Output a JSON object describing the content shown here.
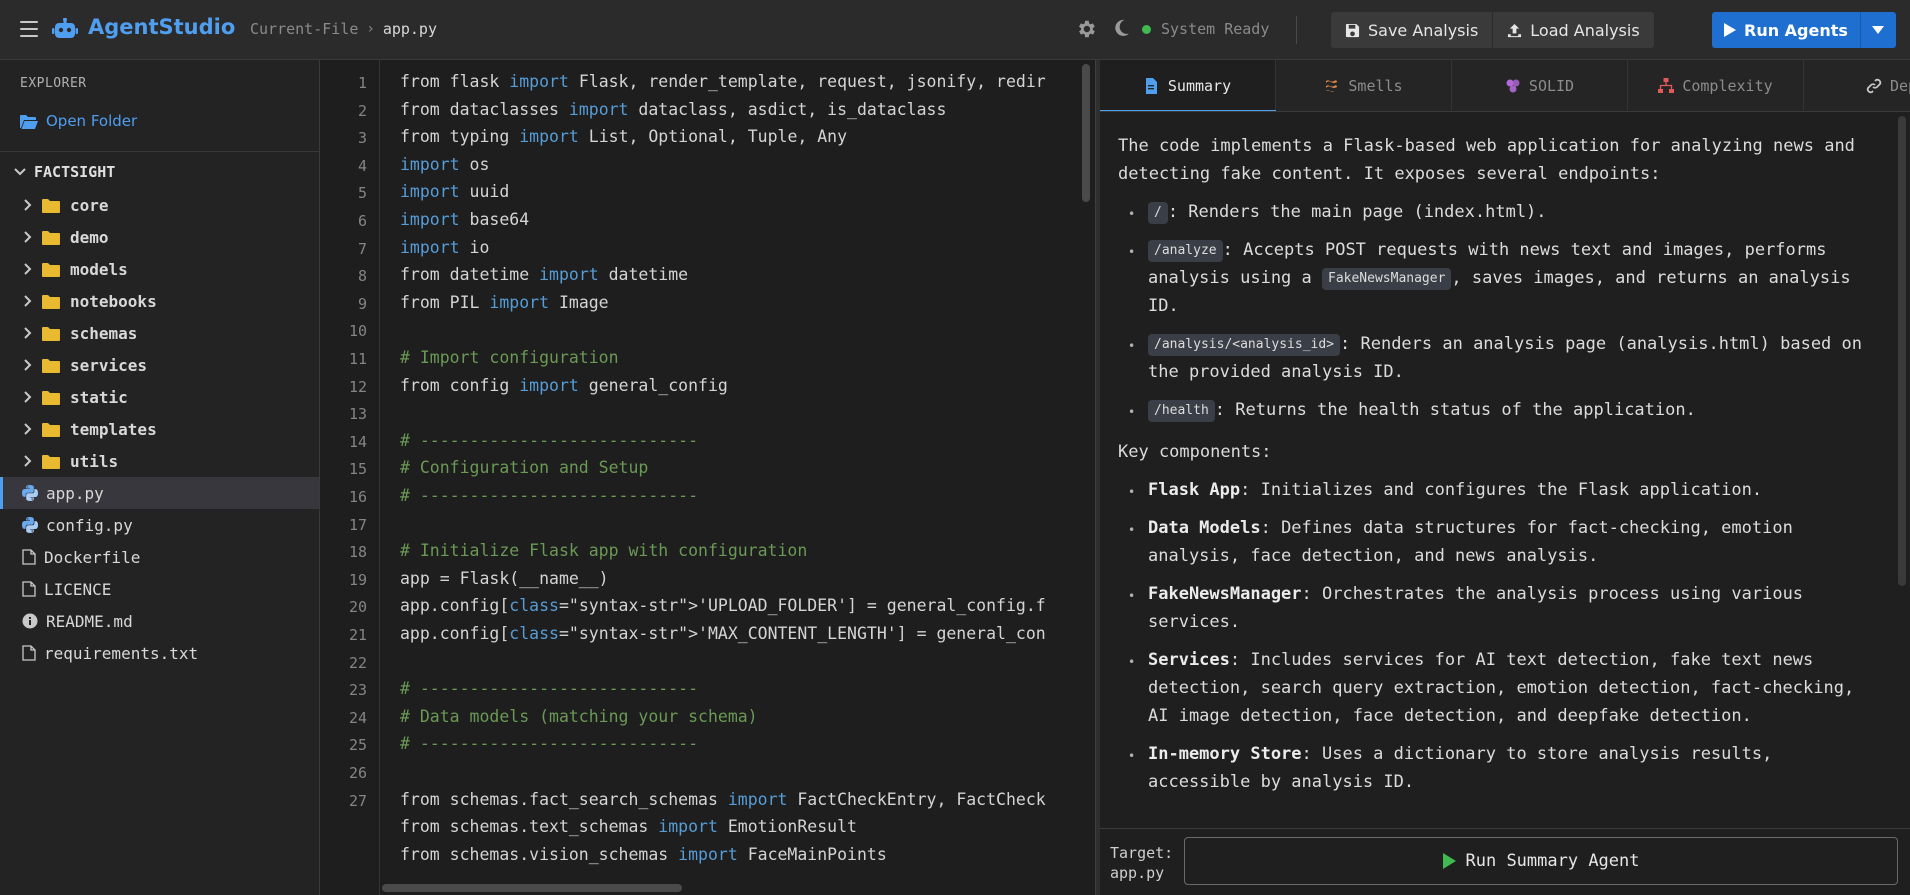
{
  "header": {
    "app_title": "AgentStudio",
    "breadcrumb_root": "Current-File",
    "breadcrumb_file": "app.py",
    "status": "System Ready",
    "save_label": "Save Analysis",
    "load_label": "Load Analysis",
    "run_label": "Run Agents"
  },
  "sidebar": {
    "title": "EXPLORER",
    "open_folder": "Open Folder",
    "project": "FACTSIGHT",
    "folders": [
      "core",
      "demo",
      "models",
      "notebooks",
      "schemas",
      "services",
      "static",
      "templates",
      "utils"
    ],
    "files": [
      {
        "name": "app.py",
        "icon": "python-icon",
        "active": true
      },
      {
        "name": "config.py",
        "icon": "python-icon",
        "active": false
      },
      {
        "name": "Dockerfile",
        "icon": "file-icon",
        "active": false
      },
      {
        "name": "LICENCE",
        "icon": "file-icon",
        "active": false
      },
      {
        "name": "README.md",
        "icon": "info-icon",
        "active": false
      },
      {
        "name": "requirements.txt",
        "icon": "file-icon",
        "active": false
      }
    ]
  },
  "editor": {
    "lines": [
      [
        [
          "",
          "from flask "
        ],
        [
          "kw",
          "import"
        ],
        [
          "",
          " Flask, render_template, request, jsonify, redir"
        ]
      ],
      [
        [
          "",
          "from dataclasses "
        ],
        [
          "kw",
          "import"
        ],
        [
          "",
          " dataclass, asdict, is_dataclass"
        ]
      ],
      [
        [
          "",
          "from typing "
        ],
        [
          "kw",
          "import"
        ],
        [
          "",
          " List, Optional, Tuple, Any"
        ]
      ],
      [
        [
          "kw",
          "import"
        ],
        [
          "",
          " os"
        ]
      ],
      [
        [
          "kw",
          "import"
        ],
        [
          "",
          " uuid"
        ]
      ],
      [
        [
          "kw",
          "import"
        ],
        [
          "",
          " base64"
        ]
      ],
      [
        [
          "kw",
          "import"
        ],
        [
          "",
          " io"
        ]
      ],
      [
        [
          "",
          "from datetime "
        ],
        [
          "kw",
          "import"
        ],
        [
          "",
          " datetime"
        ]
      ],
      [
        [
          "",
          "from PIL "
        ],
        [
          "kw",
          "import"
        ],
        [
          "",
          " Image"
        ]
      ],
      [
        [
          "",
          ""
        ]
      ],
      [
        [
          "cm",
          "# Import configuration"
        ]
      ],
      [
        [
          "",
          "from config "
        ],
        [
          "kw",
          "import"
        ],
        [
          "",
          " general_config"
        ]
      ],
      [
        [
          "",
          ""
        ]
      ],
      [
        [
          "cm",
          "# ----------------------------"
        ]
      ],
      [
        [
          "cm",
          "# Configuration and Setup"
        ]
      ],
      [
        [
          "cm",
          "# ----------------------------"
        ]
      ],
      [
        [
          "",
          ""
        ]
      ],
      [
        [
          "cm",
          "# Initialize Flask app with configuration"
        ]
      ],
      [
        [
          "",
          "app = Flask(__name__)"
        ]
      ],
      [
        [
          "",
          "app.config["
        ],
        [
          "kw",
          "class"
        ],
        [
          "",
          "=\"syntax-str\">'UPLOAD_FOLDER'] = general_config.f"
        ]
      ],
      [
        [
          "",
          "app.config["
        ],
        [
          "kw",
          "class"
        ],
        [
          "",
          "=\"syntax-str\">'MAX_CONTENT_LENGTH'] = general_con"
        ]
      ],
      [
        [
          "",
          ""
        ]
      ],
      [
        [
          "cm",
          "# ----------------------------"
        ]
      ],
      [
        [
          "cm",
          "# Data models (matching your schema)"
        ]
      ],
      [
        [
          "cm",
          "# ----------------------------"
        ]
      ],
      [
        [
          "",
          ""
        ]
      ],
      [
        [
          "",
          "from schemas.fact_search_schemas "
        ],
        [
          "kw",
          "import"
        ],
        [
          "",
          " FactCheckEntry, FactCheck"
        ]
      ],
      [
        [
          "",
          "from schemas.text_schemas "
        ],
        [
          "kw",
          "import"
        ],
        [
          "",
          " EmotionResult"
        ]
      ],
      [
        [
          "",
          "from schemas.vision_schemas "
        ],
        [
          "kw",
          "import"
        ],
        [
          "",
          " FaceMainPoints"
        ]
      ]
    ],
    "line_numbers": [
      "1",
      "2",
      "3",
      "4",
      "5",
      "6",
      "7",
      "8",
      "9",
      "10",
      "11",
      "12",
      "13",
      "14",
      "15",
      "16",
      "17",
      "18",
      "19",
      "20",
      "21",
      "22",
      "23",
      "24",
      "25",
      "26",
      "27"
    ]
  },
  "panel": {
    "tabs": [
      {
        "label": "Summary",
        "icon": "document-icon",
        "active": true
      },
      {
        "label": "Smells",
        "icon": "code-smell-icon",
        "active": false
      },
      {
        "label": "SOLID",
        "icon": "cubes-icon",
        "active": false
      },
      {
        "label": "Complexity",
        "icon": "hierarchy-icon",
        "active": false
      },
      {
        "label": "Dep",
        "icon": "link-icon",
        "active": false
      }
    ],
    "intro": "The code implements a Flask-based web application for analyzing news and detecting fake content. It exposes several endpoints:",
    "endpoints": [
      {
        "code": "/",
        "text": ": Renders the main page (index.html)."
      },
      {
        "code": "/analyze",
        "text1": ": Accepts POST requests with news text and images, performs analysis using a ",
        "code2": "FakeNewsManager",
        "text2": ", saves images, and returns an analysis ID."
      },
      {
        "code": "/analysis/<analysis_id>",
        "text": ": Renders an analysis page (analysis.html) based on the provided analysis ID."
      },
      {
        "code": "/health",
        "text": ": Returns the health status of the application."
      }
    ],
    "components_title": "Key components:",
    "components": [
      {
        "name": "Flask App",
        "text": ": Initializes and configures the Flask application."
      },
      {
        "name": "Data Models",
        "text": ": Defines data structures for fact-checking, emotion analysis, face detection, and news analysis."
      },
      {
        "name": "FakeNewsManager",
        "text": ": Orchestrates the analysis process using various services."
      },
      {
        "name": "Services",
        "text": ": Includes services for AI text detection, fake text news detection, search query extraction, emotion detection, fact-checking, AI image detection, face detection, and deepfake detection."
      },
      {
        "name": "In-memory Store",
        "text": ": Uses a dictionary to store analysis results, accessible by analysis ID."
      }
    ],
    "target_label": "Target:",
    "target_file": "app.py",
    "run_summary_label": "Run Summary Agent"
  },
  "colors": {
    "accent": "#4f9ef0",
    "run_button": "#1f6fd1",
    "status_ok": "#3fb950",
    "keyword": "#569cd6",
    "comment": "#6a9955",
    "folder": "#e8b931",
    "play": "#3fb950"
  }
}
